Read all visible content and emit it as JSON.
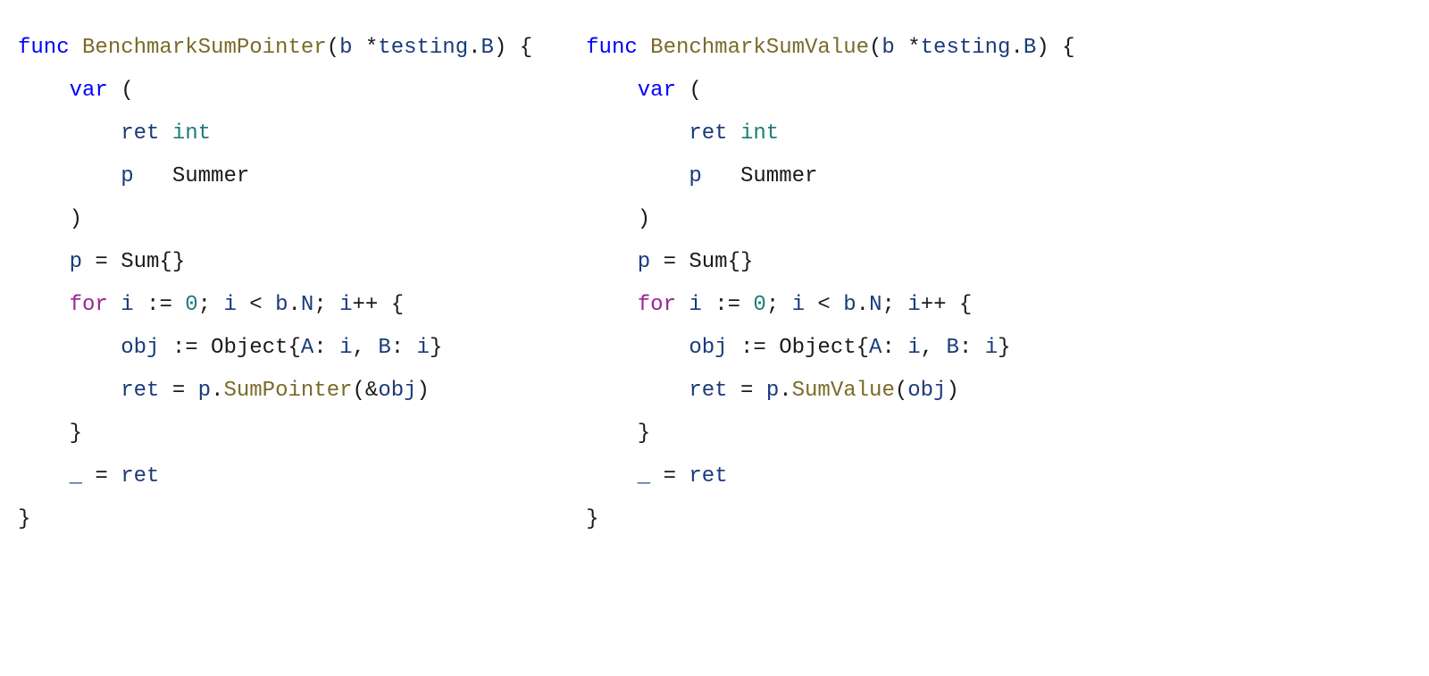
{
  "left": {
    "tokens": [
      {
        "t": "func ",
        "c": "tok-keyword-func"
      },
      {
        "t": "BenchmarkSumPointer",
        "c": "tok-funcname"
      },
      {
        "t": "(",
        "c": "tok-plain"
      },
      {
        "t": "b",
        "c": "tok-ident"
      },
      {
        "t": " *",
        "c": "tok-plain"
      },
      {
        "t": "testing",
        "c": "tok-ident"
      },
      {
        "t": ".",
        "c": "tok-plain"
      },
      {
        "t": "B",
        "c": "tok-ident"
      },
      {
        "t": ") {\n",
        "c": "tok-plain"
      },
      {
        "t": "    ",
        "c": "tok-plain"
      },
      {
        "t": "var",
        "c": "tok-keyword-var"
      },
      {
        "t": " (\n",
        "c": "tok-plain"
      },
      {
        "t": "        ",
        "c": "tok-plain"
      },
      {
        "t": "ret",
        "c": "tok-ident"
      },
      {
        "t": " ",
        "c": "tok-plain"
      },
      {
        "t": "int",
        "c": "tok-type"
      },
      {
        "t": "\n",
        "c": "tok-plain"
      },
      {
        "t": "        ",
        "c": "tok-plain"
      },
      {
        "t": "p",
        "c": "tok-ident"
      },
      {
        "t": "   Summer\n",
        "c": "tok-plain"
      },
      {
        "t": "    )\n",
        "c": "tok-plain"
      },
      {
        "t": "    ",
        "c": "tok-plain"
      },
      {
        "t": "p",
        "c": "tok-ident"
      },
      {
        "t": " = Sum{}\n",
        "c": "tok-plain"
      },
      {
        "t": "    ",
        "c": "tok-plain"
      },
      {
        "t": "for",
        "c": "tok-keyword-for"
      },
      {
        "t": " ",
        "c": "tok-plain"
      },
      {
        "t": "i",
        "c": "tok-ident"
      },
      {
        "t": " := ",
        "c": "tok-plain"
      },
      {
        "t": "0",
        "c": "tok-number"
      },
      {
        "t": "; ",
        "c": "tok-plain"
      },
      {
        "t": "i",
        "c": "tok-ident"
      },
      {
        "t": " < ",
        "c": "tok-plain"
      },
      {
        "t": "b",
        "c": "tok-ident"
      },
      {
        "t": ".",
        "c": "tok-plain"
      },
      {
        "t": "N",
        "c": "tok-ident"
      },
      {
        "t": "; ",
        "c": "tok-plain"
      },
      {
        "t": "i",
        "c": "tok-ident"
      },
      {
        "t": "++ {\n",
        "c": "tok-plain"
      },
      {
        "t": "        ",
        "c": "tok-plain"
      },
      {
        "t": "obj",
        "c": "tok-ident"
      },
      {
        "t": " := Object{",
        "c": "tok-plain"
      },
      {
        "t": "A",
        "c": "tok-ident"
      },
      {
        "t": ": ",
        "c": "tok-plain"
      },
      {
        "t": "i",
        "c": "tok-ident"
      },
      {
        "t": ", ",
        "c": "tok-plain"
      },
      {
        "t": "B",
        "c": "tok-ident"
      },
      {
        "t": ": ",
        "c": "tok-plain"
      },
      {
        "t": "i",
        "c": "tok-ident"
      },
      {
        "t": "}\n",
        "c": "tok-plain"
      },
      {
        "t": "        ",
        "c": "tok-plain"
      },
      {
        "t": "ret",
        "c": "tok-ident"
      },
      {
        "t": " = ",
        "c": "tok-plain"
      },
      {
        "t": "p",
        "c": "tok-ident"
      },
      {
        "t": ".",
        "c": "tok-plain"
      },
      {
        "t": "SumPointer",
        "c": "tok-method"
      },
      {
        "t": "(&",
        "c": "tok-plain"
      },
      {
        "t": "obj",
        "c": "tok-ident"
      },
      {
        "t": ")\n",
        "c": "tok-plain"
      },
      {
        "t": "    }\n",
        "c": "tok-plain"
      },
      {
        "t": "    ",
        "c": "tok-plain"
      },
      {
        "t": "_",
        "c": "tok-ident"
      },
      {
        "t": " = ",
        "c": "tok-plain"
      },
      {
        "t": "ret",
        "c": "tok-ident"
      },
      {
        "t": "\n",
        "c": "tok-plain"
      },
      {
        "t": "}",
        "c": "tok-plain"
      }
    ]
  },
  "right": {
    "tokens": [
      {
        "t": "func ",
        "c": "tok-keyword-func"
      },
      {
        "t": "BenchmarkSumValue",
        "c": "tok-funcname"
      },
      {
        "t": "(",
        "c": "tok-plain"
      },
      {
        "t": "b",
        "c": "tok-ident"
      },
      {
        "t": " *",
        "c": "tok-plain"
      },
      {
        "t": "testing",
        "c": "tok-ident"
      },
      {
        "t": ".",
        "c": "tok-plain"
      },
      {
        "t": "B",
        "c": "tok-ident"
      },
      {
        "t": ") {\n",
        "c": "tok-plain"
      },
      {
        "t": "    ",
        "c": "tok-plain"
      },
      {
        "t": "var",
        "c": "tok-keyword-var"
      },
      {
        "t": " (\n",
        "c": "tok-plain"
      },
      {
        "t": "        ",
        "c": "tok-plain"
      },
      {
        "t": "ret",
        "c": "tok-ident"
      },
      {
        "t": " ",
        "c": "tok-plain"
      },
      {
        "t": "int",
        "c": "tok-type"
      },
      {
        "t": "\n",
        "c": "tok-plain"
      },
      {
        "t": "        ",
        "c": "tok-plain"
      },
      {
        "t": "p",
        "c": "tok-ident"
      },
      {
        "t": "   Summer\n",
        "c": "tok-plain"
      },
      {
        "t": "    )\n",
        "c": "tok-plain"
      },
      {
        "t": "    ",
        "c": "tok-plain"
      },
      {
        "t": "p",
        "c": "tok-ident"
      },
      {
        "t": " = Sum{}\n",
        "c": "tok-plain"
      },
      {
        "t": "    ",
        "c": "tok-plain"
      },
      {
        "t": "for",
        "c": "tok-keyword-for"
      },
      {
        "t": " ",
        "c": "tok-plain"
      },
      {
        "t": "i",
        "c": "tok-ident"
      },
      {
        "t": " := ",
        "c": "tok-plain"
      },
      {
        "t": "0",
        "c": "tok-number"
      },
      {
        "t": "; ",
        "c": "tok-plain"
      },
      {
        "t": "i",
        "c": "tok-ident"
      },
      {
        "t": " < ",
        "c": "tok-plain"
      },
      {
        "t": "b",
        "c": "tok-ident"
      },
      {
        "t": ".",
        "c": "tok-plain"
      },
      {
        "t": "N",
        "c": "tok-ident"
      },
      {
        "t": "; ",
        "c": "tok-plain"
      },
      {
        "t": "i",
        "c": "tok-ident"
      },
      {
        "t": "++ {\n",
        "c": "tok-plain"
      },
      {
        "t": "        ",
        "c": "tok-plain"
      },
      {
        "t": "obj",
        "c": "tok-ident"
      },
      {
        "t": " := Object{",
        "c": "tok-plain"
      },
      {
        "t": "A",
        "c": "tok-ident"
      },
      {
        "t": ": ",
        "c": "tok-plain"
      },
      {
        "t": "i",
        "c": "tok-ident"
      },
      {
        "t": ", ",
        "c": "tok-plain"
      },
      {
        "t": "B",
        "c": "tok-ident"
      },
      {
        "t": ": ",
        "c": "tok-plain"
      },
      {
        "t": "i",
        "c": "tok-ident"
      },
      {
        "t": "}\n",
        "c": "tok-plain"
      },
      {
        "t": "        ",
        "c": "tok-plain"
      },
      {
        "t": "ret",
        "c": "tok-ident"
      },
      {
        "t": " = ",
        "c": "tok-plain"
      },
      {
        "t": "p",
        "c": "tok-ident"
      },
      {
        "t": ".",
        "c": "tok-plain"
      },
      {
        "t": "SumValue",
        "c": "tok-method"
      },
      {
        "t": "(",
        "c": "tok-plain"
      },
      {
        "t": "obj",
        "c": "tok-ident"
      },
      {
        "t": ")\n",
        "c": "tok-plain"
      },
      {
        "t": "    }\n",
        "c": "tok-plain"
      },
      {
        "t": "    ",
        "c": "tok-plain"
      },
      {
        "t": "_",
        "c": "tok-ident"
      },
      {
        "t": " = ",
        "c": "tok-plain"
      },
      {
        "t": "ret",
        "c": "tok-ident"
      },
      {
        "t": "\n",
        "c": "tok-plain"
      },
      {
        "t": "}",
        "c": "tok-plain"
      }
    ]
  }
}
